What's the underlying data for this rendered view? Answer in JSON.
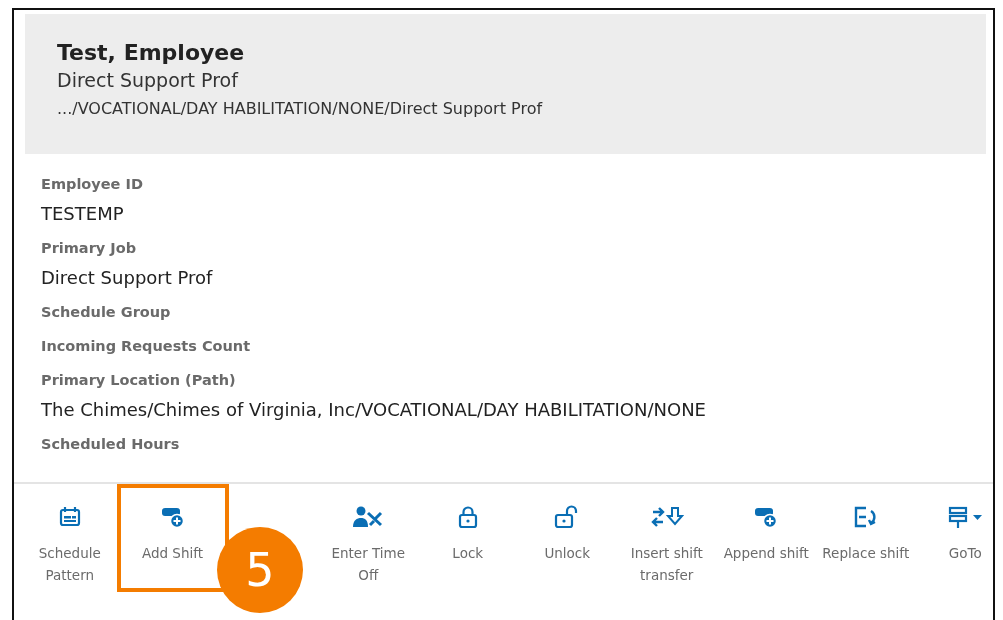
{
  "header": {
    "name": "Test, Employee",
    "job": "Direct Support Prof",
    "path": ".../VOCATIONAL/DAY HABILITATION/NONE/Direct Support Prof"
  },
  "fields": [
    {
      "label": "Employee ID",
      "value": "TESTEMP"
    },
    {
      "label": "Primary Job",
      "value": "Direct Support Prof"
    },
    {
      "label": "Schedule Group"
    },
    {
      "label": "Incoming Requests Count"
    },
    {
      "label": "Primary Location (Path)",
      "value": "The Chimes/Chimes of Virginia, Inc/VOCATIONAL/DAY HABILITATION/NONE"
    },
    {
      "label": "Scheduled Hours"
    }
  ],
  "toolbar": [
    {
      "kind": "calendar",
      "label": "Schedule Pattern",
      "highlighted": false
    },
    {
      "kind": "add",
      "label": "Add Shift",
      "highlighted": true
    },
    {
      "kind": "hidden"
    },
    {
      "kind": "timeoff",
      "label": "Enter Time Off",
      "highlighted": false
    },
    {
      "kind": "lock",
      "label": "Lock",
      "highlighted": false
    },
    {
      "kind": "unlock",
      "label": "Unlock",
      "highlighted": false
    },
    {
      "kind": "transfer",
      "label": "Insert shift transfer",
      "highlighted": false
    },
    {
      "kind": "add",
      "label": "Append shift",
      "highlighted": false
    },
    {
      "kind": "replace",
      "label": "Replace shift",
      "highlighted": false
    },
    {
      "kind": "goto",
      "label": "GoTo",
      "highlighted": false
    }
  ],
  "callout": {
    "number": "5"
  }
}
